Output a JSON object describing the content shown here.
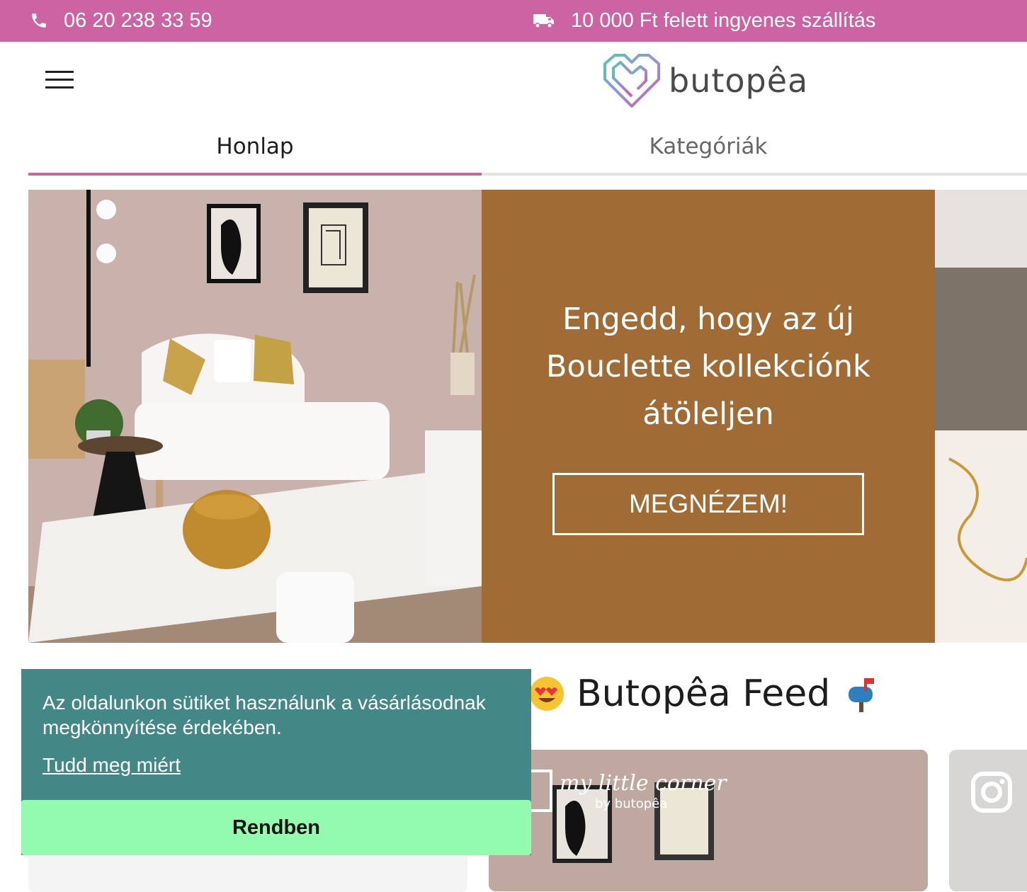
{
  "topbar": {
    "phone": "06 20 238 33 59",
    "shipping": "10 000 Ft felett ingyenes szállítás",
    "phone_icon": "phone-icon",
    "shipping_icon": "truck-icon"
  },
  "header": {
    "logo_text": "butopêa",
    "menu_icon": "hamburger-menu-icon"
  },
  "tabs": [
    {
      "label": "Honlap",
      "active": true
    },
    {
      "label": "Kategóriák",
      "active": false
    }
  ],
  "hero": {
    "headline": "Engedd, hogy az új Bouclette kollekciónk átöleljen",
    "cta_label": "MEGNÉZEM!"
  },
  "feed": {
    "title": "Butopêa Feed",
    "card_caption_1": "my little corner",
    "card_caption_2": "by butopêa",
    "instagram_icon": "instagram-icon"
  },
  "cookie": {
    "message": "Az oldalunkon sütiket használunk a vásárlásodnak megkönnyítése érdekében.",
    "learn_more": "Tudd meg miért",
    "accept": "Rendben"
  },
  "colors": {
    "brand_pink": "#cc64a3",
    "hero_brown": "#a06b35",
    "cookie_teal": "#438886",
    "cookie_button": "#93fbb0"
  }
}
